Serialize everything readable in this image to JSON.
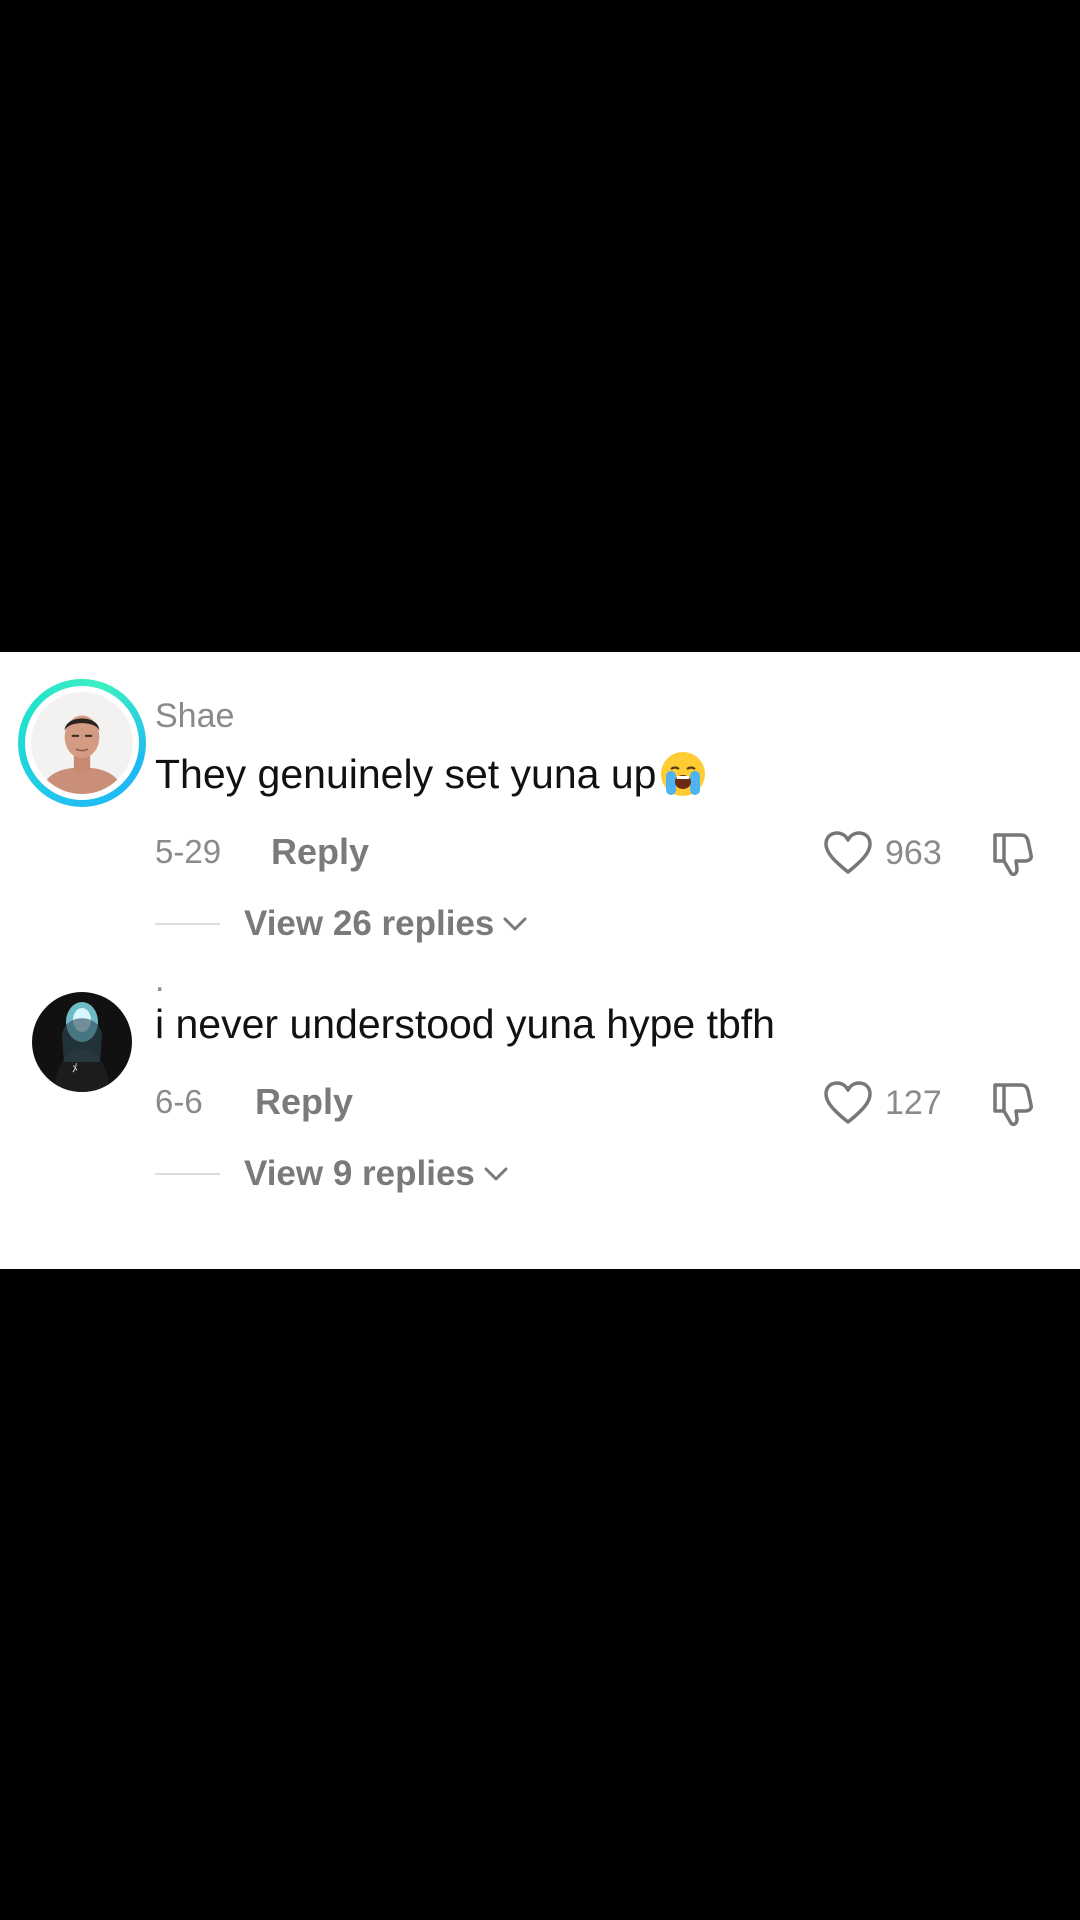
{
  "comments": [
    {
      "username": "Shae",
      "text": "They genuinely set yuna up",
      "emoji": "loudly-crying-face-emoji",
      "date": "5-29",
      "reply_label": "Reply",
      "likes": "963",
      "view_replies": "View 26 replies",
      "avatar_ring_color": "#22c2f0"
    },
    {
      "username": ".",
      "text": "i never understood yuna hype tbfh",
      "date": "6-6",
      "reply_label": "Reply",
      "likes": "127",
      "view_replies": "View 9 replies"
    }
  ],
  "colors": {
    "background": "#000000",
    "panel": "#ffffff",
    "muted_text": "#8a8a8a",
    "primary_text": "#111111"
  }
}
